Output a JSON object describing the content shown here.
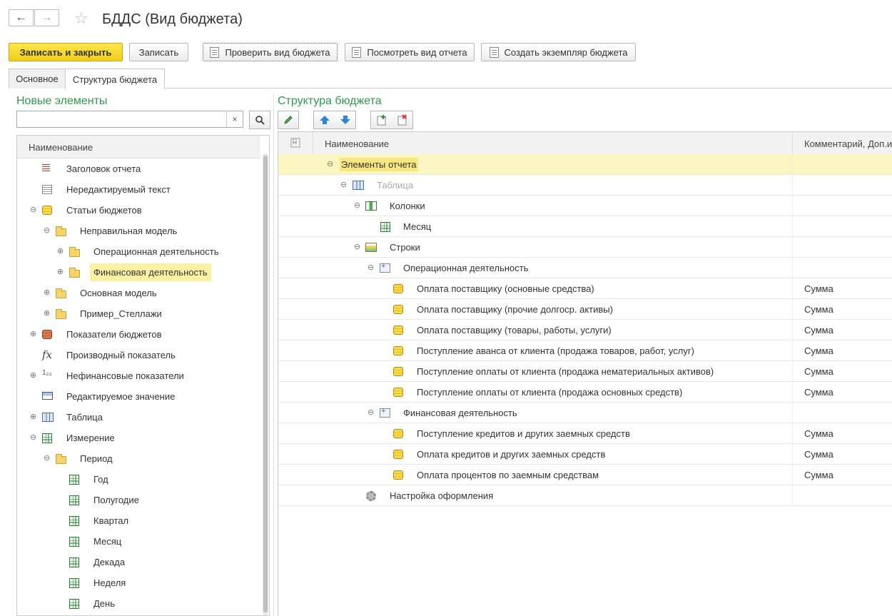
{
  "window": {
    "title": "БДДС (Вид бюджета)"
  },
  "nav": {
    "back": "←",
    "forward": "→",
    "favorite": "☆"
  },
  "toolbar": {
    "save_close": "Записать и закрыть",
    "save": "Записать",
    "check_budget": "Проверить вид бюджета",
    "view_report": "Посмотреть вид отчета",
    "create_instance": "Создать экземпляр бюджета"
  },
  "tabs": [
    {
      "label": "Основное"
    },
    {
      "label": "Структура бюджета"
    }
  ],
  "left": {
    "header": "Новые элементы",
    "search": {
      "value": "",
      "placeholder": "",
      "clear": "×"
    },
    "column": "Наименование",
    "items": [
      {
        "label": "Заголовок отчета",
        "icon": "header-lines-icon"
      },
      {
        "label": "Нередактируемый текст",
        "icon": "text-icon"
      },
      {
        "label": "Статьи бюджетов",
        "icon": "coins-icon",
        "expander": "⊖"
      },
      {
        "label": "Неправильная модель",
        "icon": "folder-icon",
        "expander": "⊖"
      },
      {
        "label": "Операционная деятельность",
        "icon": "folder-icon",
        "expander": "⊕"
      },
      {
        "label": "Финансовая деятельность",
        "icon": "folder-icon",
        "expander": "⊕",
        "selected": true
      },
      {
        "label": "Основная модель",
        "icon": "folder-icon",
        "expander": "⊕"
      },
      {
        "label": "Пример_Стеллажи",
        "icon": "folder-icon",
        "expander": "⊕"
      },
      {
        "label": "Показатели бюджетов",
        "icon": "coins-red-icon",
        "expander": "⊕"
      },
      {
        "label": "Производный показатель",
        "icon": "fx-icon",
        "glyph": "fx"
      },
      {
        "label": "Нефинансовые показатели",
        "icon": "number-icon",
        "expander": "⊕",
        "glyph": "1₂₃"
      },
      {
        "label": "Редактируемое значение",
        "icon": "edit-value-icon"
      },
      {
        "label": "Таблица",
        "icon": "table-icon",
        "expander": "⊕"
      },
      {
        "label": "Измерение",
        "icon": "grid-icon",
        "expander": "⊖"
      },
      {
        "label": "Период",
        "icon": "folder-icon",
        "expander": "⊖"
      },
      {
        "label": "Год",
        "icon": "grid-icon"
      },
      {
        "label": "Полугодие",
        "icon": "grid-icon"
      },
      {
        "label": "Квартал",
        "icon": "grid-icon"
      },
      {
        "label": "Месяц",
        "icon": "grid-icon"
      },
      {
        "label": "Декада",
        "icon": "grid-icon"
      },
      {
        "label": "Неделя",
        "icon": "grid-icon"
      },
      {
        "label": "День",
        "icon": "grid-icon"
      }
    ]
  },
  "right": {
    "header": "Структура бюджета",
    "columns": {
      "name": "Наименование",
      "comment": "Комментарий, Доп.и"
    },
    "rows": [
      {
        "label": "Элементы отчета",
        "expander": "⊖",
        "selected": true
      },
      {
        "label": "Таблица",
        "icon": "table-icon",
        "expander": "⊖",
        "dim": true
      },
      {
        "label": "Колонки",
        "icon": "columns-icon",
        "expander": "⊖"
      },
      {
        "label": "Месяц",
        "icon": "grid-icon"
      },
      {
        "label": "Строки",
        "icon": "rows-icon",
        "expander": "⊖"
      },
      {
        "label": "Операционная деятельность",
        "icon": "plus-box-icon",
        "expander": "⊖"
      },
      {
        "label": "Оплата поставщику (основные средства)",
        "icon": "coins-icon",
        "comment": "Сумма"
      },
      {
        "label": "Оплата поставщику (прочие долгоср. активы)",
        "icon": "coins-icon",
        "comment": "Сумма"
      },
      {
        "label": "Оплата поставщику (товары, работы, услуги)",
        "icon": "coins-icon",
        "comment": "Сумма"
      },
      {
        "label": "Поступление аванса от клиента (продажа товаров, работ, услуг)",
        "icon": "coins-icon",
        "comment": "Сумма"
      },
      {
        "label": "Поступление оплаты от клиента (продажа нематериальных активов)",
        "icon": "coins-icon",
        "comment": "Сумма"
      },
      {
        "label": "Поступление оплаты от клиента (продажа основных средств)",
        "icon": "coins-icon",
        "comment": "Сумма"
      },
      {
        "label": "Финансовая деятельность",
        "icon": "plus-box-icon",
        "expander": "⊖"
      },
      {
        "label": "Поступление кредитов и других заемных средств",
        "icon": "coins-icon",
        "comment": "Сумма"
      },
      {
        "label": "Оплата кредитов и других заемных средств",
        "icon": "coins-icon",
        "comment": "Сумма"
      },
      {
        "label": "Оплата процентов по заемным средствам",
        "icon": "coins-icon",
        "comment": "Сумма"
      },
      {
        "label": "Настройка оформления",
        "icon": "gear-icon"
      }
    ]
  },
  "colors": {
    "accent_green": "#2e9a4c",
    "primary_button": "#f4cc1c",
    "selection": "#fbf1a4"
  }
}
